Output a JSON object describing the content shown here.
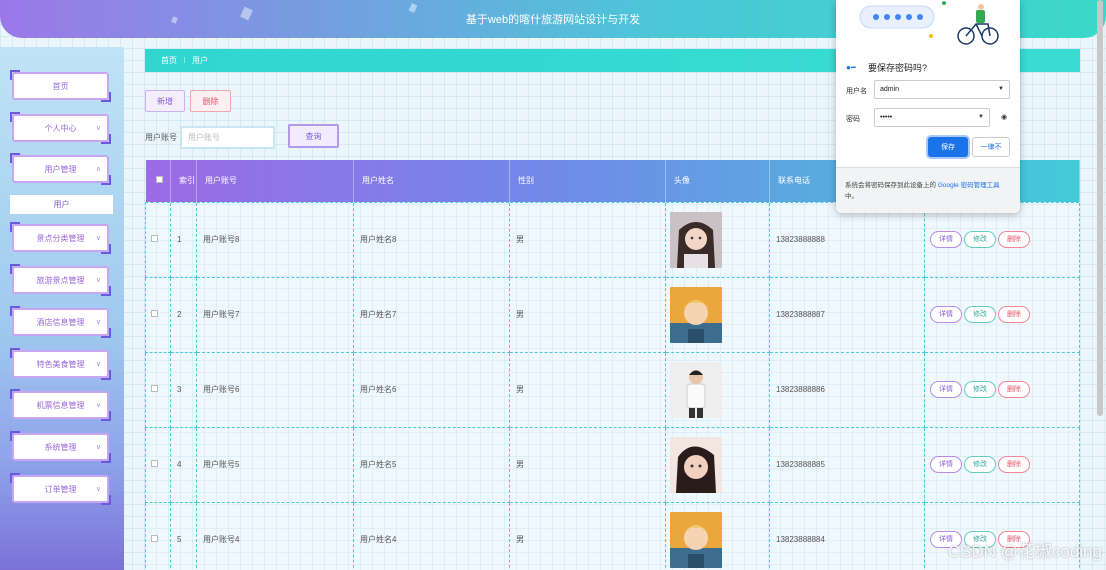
{
  "header": {
    "title": "基于web的喀什旅游网站设计与开发"
  },
  "sidebar": {
    "items": [
      {
        "label": "首页",
        "chevron": ""
      },
      {
        "label": "个人中心",
        "chevron": "∨"
      },
      {
        "label": "用户管理",
        "chevron": "∧"
      },
      {
        "label": "景点分类管理",
        "chevron": "∨"
      },
      {
        "label": "旅游景点管理",
        "chevron": "∨"
      },
      {
        "label": "酒店信息管理",
        "chevron": "∨"
      },
      {
        "label": "特色美食管理",
        "chevron": "∨"
      },
      {
        "label": "机票信息管理",
        "chevron": "∨"
      },
      {
        "label": "系统管理",
        "chevron": "∨"
      },
      {
        "label": "订单管理",
        "chevron": "∨"
      }
    ],
    "submenu": {
      "label": "用户"
    }
  },
  "breadcrumb": {
    "home": "首页",
    "sep": "⁝",
    "current": "用户"
  },
  "toolbar": {
    "add_label": "新增",
    "delete_label": "删除"
  },
  "search": {
    "label": "用户账号",
    "placeholder": "用户账号",
    "button_label": "查询"
  },
  "table": {
    "headers": [
      "",
      "索引",
      "用户账号",
      "用户姓名",
      "性别",
      "头像",
      "联系电话",
      ""
    ],
    "rows": [
      {
        "index": "1",
        "account": "用户账号8",
        "name": "用户姓名8",
        "gender": "男",
        "phone": "13823888888",
        "avatar": "avatar-female-1"
      },
      {
        "index": "2",
        "account": "用户账号7",
        "name": "用户姓名7",
        "gender": "男",
        "phone": "13823888887",
        "avatar": "avatar-cartoon"
      },
      {
        "index": "3",
        "account": "用户账号6",
        "name": "用户姓名6",
        "gender": "男",
        "phone": "13823888886",
        "avatar": "avatar-male"
      },
      {
        "index": "4",
        "account": "用户账号5",
        "name": "用户姓名5",
        "gender": "男",
        "phone": "13823888885",
        "avatar": "avatar-female-2"
      },
      {
        "index": "5",
        "account": "用户账号4",
        "name": "用户姓名4",
        "gender": "男",
        "phone": "13823888884",
        "avatar": "avatar-cartoon"
      }
    ],
    "actions": {
      "detail": "详情",
      "edit": "修改",
      "delete": "删除"
    }
  },
  "password_popup": {
    "title": "要保存密码吗?",
    "username_label": "用户名",
    "username_value": "admin",
    "password_label": "密码",
    "password_value": "•••••",
    "save_label": "保存",
    "never_label": "一律不",
    "footer_text": "系统会将密码保存到此设备上的 ",
    "footer_link": "Google 密码管理工具",
    "footer_end": "中。"
  },
  "watermark": "CSDN @花椒coding",
  "colors": {
    "accent_purple": "#9b78e8",
    "accent_teal": "#3ad8c9",
    "save_blue": "#1a73e8"
  }
}
